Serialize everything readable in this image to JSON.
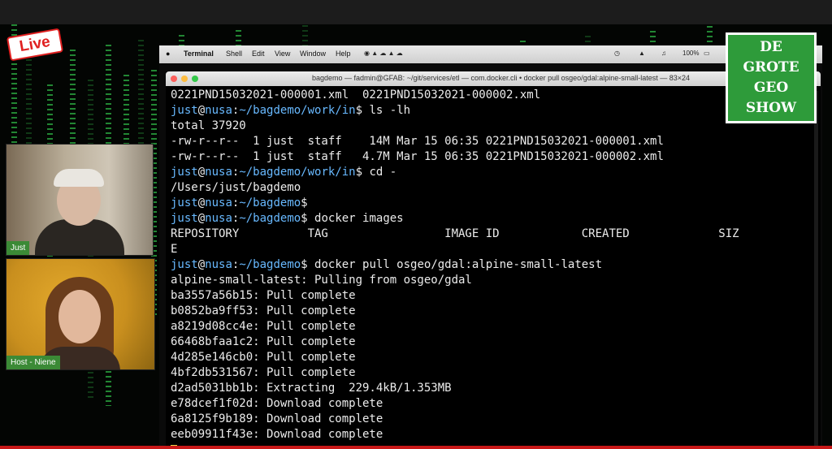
{
  "live_badge": "Live",
  "logo": {
    "line1": "DE",
    "line2": "GROTE",
    "line3": "GEO",
    "line4": "SHOW"
  },
  "participants": [
    {
      "name": "Just"
    },
    {
      "name": "Host - Niene"
    }
  ],
  "menubar": {
    "items": [
      "Terminal",
      "Shell",
      "Edit",
      "View",
      "Window",
      "Help"
    ],
    "battery": "100%"
  },
  "window": {
    "title": "bagdemo — fadmin@GFAB: ~/git/services/etl — com.docker.cli • docker pull osgeo/gdal:alpine-small-latest — 83×24"
  },
  "terminal": {
    "prompt": {
      "user": "just",
      "host": "nusa"
    },
    "lines": [
      {
        "t": "0221PND15032021-000001.xml  0221PND15032021-000002.xml"
      },
      {
        "path": "~/bagdemo/work/in",
        "cmd": " ls -lh"
      },
      {
        "t": "total 37920"
      },
      {
        "t": "-rw-r--r--  1 just  staff    14M Mar 15 06:35 0221PND15032021-000001.xml"
      },
      {
        "t": "-rw-r--r--  1 just  staff   4.7M Mar 15 06:35 0221PND15032021-000002.xml"
      },
      {
        "path": "~/bagdemo/work/in",
        "cmd": " cd -"
      },
      {
        "t": "/Users/just/bagdemo"
      },
      {
        "path": "~/bagdemo",
        "cmd": ""
      },
      {
        "path": "~/bagdemo",
        "cmd": " docker images"
      },
      {
        "t": "REPOSITORY          TAG                 IMAGE ID            CREATED             SIZ"
      },
      {
        "t": "E"
      },
      {
        "path": "~/bagdemo",
        "cmd": " docker pull osgeo/gdal:alpine-small-latest"
      },
      {
        "t": "alpine-small-latest: Pulling from osgeo/gdal"
      },
      {
        "t": "ba3557a56b15: Pull complete"
      },
      {
        "t": "b0852ba9ff53: Pull complete"
      },
      {
        "t": "a8219d08cc4e: Pull complete"
      },
      {
        "t": "66468bfaa1c2: Pull complete"
      },
      {
        "t": "4d285e146cb0: Pull complete"
      },
      {
        "t": "4bf2db531567: Pull complete"
      },
      {
        "t": "d2ad5031bb1b: Extracting  229.4kB/1.353MB"
      },
      {
        "t": "e78dcef1f02d: Download complete"
      },
      {
        "t": "6a8125f9b189: Download complete"
      },
      {
        "t": "eeb09911f43e: Download complete"
      }
    ]
  },
  "colors": {
    "prompt": "#68b9ff",
    "logo_bg": "#2e9b3a",
    "live_red": "#e02020"
  }
}
